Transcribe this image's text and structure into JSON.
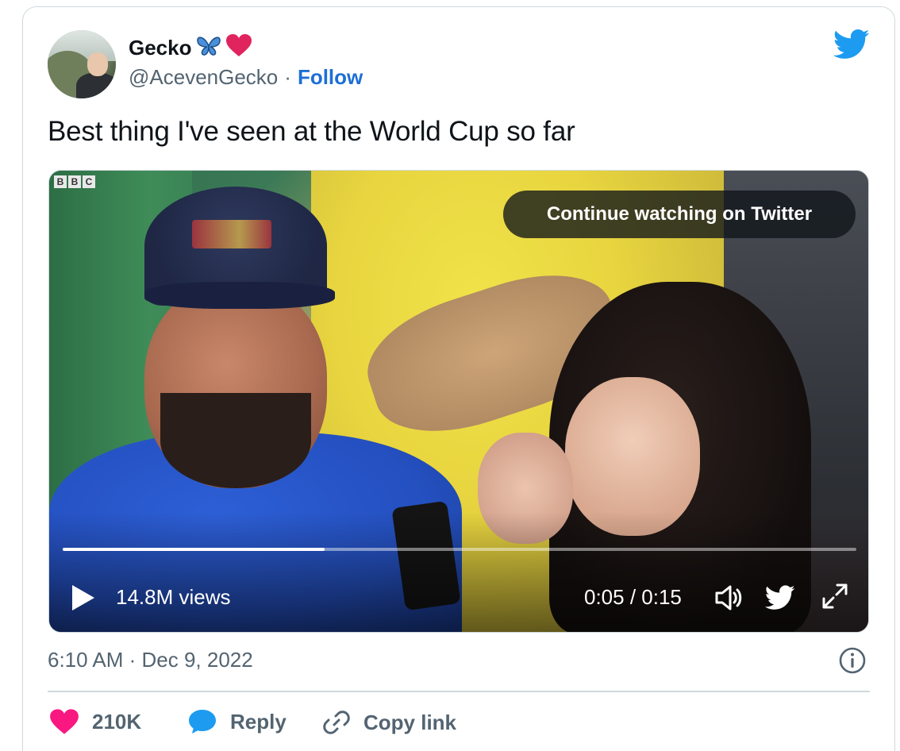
{
  "author": {
    "display_name": "Gecko",
    "handle": "@AcevenGecko",
    "separator": "·",
    "follow_label": "Follow"
  },
  "tweet": {
    "text": "Best thing I've seen at the World Cup so far",
    "timestamp": "6:10 AM · Dec 9, 2022"
  },
  "video": {
    "channel_logo": [
      "B",
      "B",
      "C"
    ],
    "continue_label": "Continue watching on Twitter",
    "views": "14.8M views",
    "time": "0:05 / 0:15",
    "progress": 0.33
  },
  "actions": {
    "likes": "210K",
    "reply_label": "Reply",
    "copy_label": "Copy link"
  },
  "colors": {
    "twitter_blue": "#1d9bf0",
    "like_pink": "#f91880",
    "follow_blue": "#1d6fd6",
    "muted_text": "#536471"
  },
  "icons": [
    "twitter-logo",
    "butterfly",
    "heart",
    "play",
    "volume",
    "expand",
    "info",
    "reply-bubble",
    "link"
  ]
}
